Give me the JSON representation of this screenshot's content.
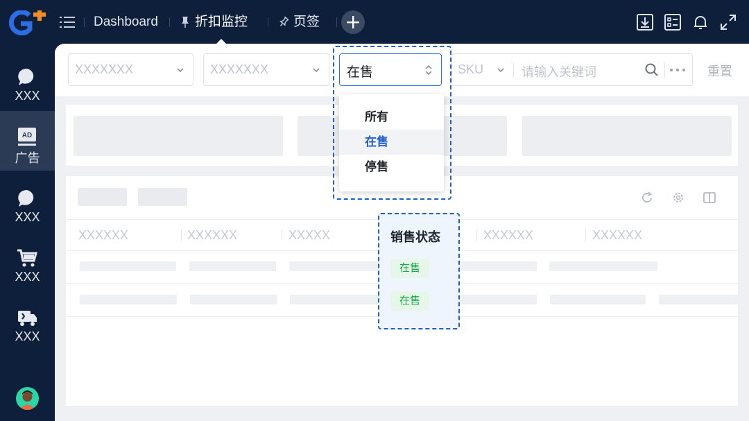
{
  "topbar": {
    "logo_icon": "brand-logo-g-plus",
    "menu_icon": "menu-collapse-icon",
    "tabs": [
      {
        "label": "Dashboard",
        "icon": ""
      },
      {
        "label": "折扣监控",
        "icon": "pin-icon"
      },
      {
        "label": "页签",
        "icon": "pin-outline-icon"
      }
    ],
    "add_tab_icon": "plus-icon",
    "actions": [
      "download-icon",
      "checklist-icon",
      "bell-icon",
      "fullscreen-icon"
    ]
  },
  "sidebar": {
    "items": [
      {
        "label": "XXX",
        "icon": "chat-bubble-icon"
      },
      {
        "label": "广告",
        "icon": "ad-icon",
        "active": true
      },
      {
        "label": "XXX",
        "icon": "chat-bubble-icon"
      },
      {
        "label": "XXX",
        "icon": "cart-icon"
      },
      {
        "label": "XXX",
        "icon": "delivery-truck-icon"
      }
    ],
    "avatar_icon": "user-avatar"
  },
  "filters": {
    "select1_placeholder": "XXXXXXX",
    "select2_placeholder": "XXXXXXX",
    "status_value": "在售",
    "sku_label": "SKU",
    "keyword_placeholder": "请输入关键词",
    "reset_label": "重置"
  },
  "dropdown": {
    "options": [
      "所有",
      "在售",
      "停售"
    ],
    "selected": "在售"
  },
  "table": {
    "toolbar_icons": [
      "refresh-icon",
      "settings-icon",
      "columns-icon"
    ],
    "headers": [
      "XXXXXX",
      "XXXXXX",
      "XXXXX",
      "销售状态",
      "XXXXXX",
      "XXXXXX"
    ],
    "status_tags": [
      "在售",
      "在售"
    ]
  },
  "colors": {
    "nav_bg": "#0d1f3a",
    "accent": "#1f5fcc",
    "tag_green": "#18a64a"
  }
}
